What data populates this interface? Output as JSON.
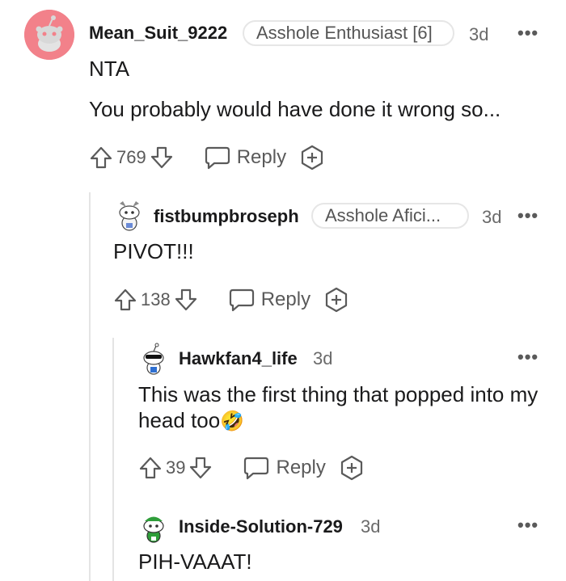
{
  "comments": [
    {
      "username": "Mean_Suit_9222",
      "flair": "Asshole Enthusiast [6]",
      "time": "3d",
      "body": [
        "NTA",
        "You probably would have done it wrong so..."
      ],
      "votes": "769",
      "reply_label": "Reply",
      "avatar_color": "#f2818a"
    },
    {
      "username": "fistbumpbroseph",
      "flair": "Asshole Afici...",
      "time": "3d",
      "body": [
        "PIVOT!!!"
      ],
      "votes": "138",
      "reply_label": "Reply"
    },
    {
      "username": "Hawkfan4_life",
      "time": "3d",
      "body": [
        "This was the first thing that popped into my head too"
      ],
      "emoji": "🤣",
      "votes": "39",
      "reply_label": "Reply"
    },
    {
      "username": "Inside-Solution-729",
      "time": "3d",
      "body": [
        "PIH-VAAAT!"
      ]
    }
  ],
  "icons": {
    "menu": "more-options-icon",
    "upvote": "upvote-arrow-icon",
    "downvote": "downvote-arrow-icon",
    "reply": "speech-bubble-icon",
    "award": "award-plus-icon"
  },
  "colors": {
    "thread_line": "#e4e4e4",
    "text_muted": "#5a5a5a"
  }
}
